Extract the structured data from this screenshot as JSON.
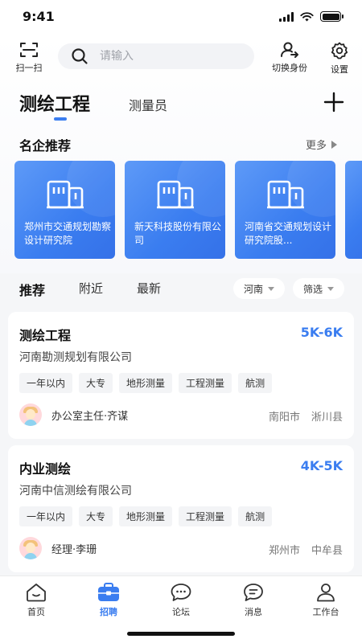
{
  "status_bar": {
    "time": "9:41"
  },
  "header": {
    "scan_label": "扫一扫",
    "search_placeholder": "请输入",
    "switch_identity_label": "切换身份",
    "settings_label": "设置"
  },
  "tabs": {
    "active": "测绘工程",
    "second": "测量员"
  },
  "featured": {
    "title": "名企推荐",
    "more_label": "更多",
    "companies": [
      {
        "name": "郑州市交通规划勘察设计研究院"
      },
      {
        "name": "新天科技股份有限公司"
      },
      {
        "name": "河南省交通规划设计研究院股..."
      }
    ]
  },
  "filters": {
    "tabs": [
      "推荐",
      "附近",
      "最新"
    ],
    "region": "河南",
    "filter_label": "筛选"
  },
  "jobs": [
    {
      "title": "测绘工程",
      "salary": "5K-6K",
      "company": "河南勘测规划有限公司",
      "tags": [
        "一年以内",
        "大专",
        "地形测量",
        "工程测量",
        "航测"
      ],
      "recruiter": "办公室主任·齐谋",
      "city": "南阳市",
      "district": "淅川县"
    },
    {
      "title": "内业测绘",
      "salary": "4K-5K",
      "company": "河南中信测绘有限公司",
      "tags": [
        "一年以内",
        "大专",
        "地形测量",
        "工程测量",
        "航测"
      ],
      "recruiter": "经理·李珊",
      "city": "郑州市",
      "district": "中牟县"
    }
  ],
  "bottom_nav": [
    {
      "label": "首页",
      "icon": "home-icon"
    },
    {
      "label": "招聘",
      "icon": "briefcase-icon",
      "active": true
    },
    {
      "label": "论坛",
      "icon": "chat-bubble-icon"
    },
    {
      "label": "消息",
      "icon": "message-icon"
    },
    {
      "label": "工作台",
      "icon": "user-icon"
    }
  ],
  "colors": {
    "accent": "#3a7df0",
    "card_gradient_start": "#5e9af7",
    "card_gradient_end": "#3571e8"
  }
}
